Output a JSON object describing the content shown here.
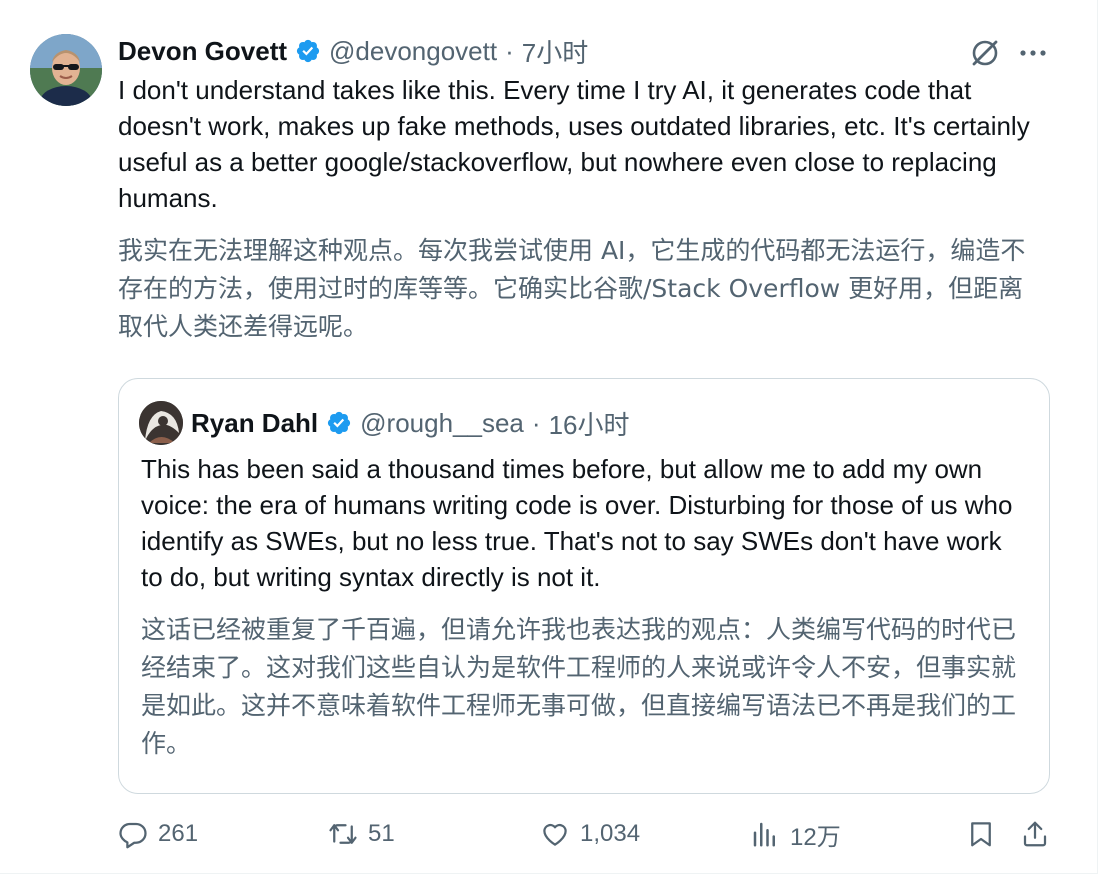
{
  "post": {
    "author_name": "Devon Govett",
    "handle": "@devongovett",
    "separator": "·",
    "time": "7小时",
    "text": "I don't understand takes like this. Every time I try AI, it generates code that doesn't work, makes up fake methods, uses outdated libraries, etc. It's certainly useful as a better google/stackoverflow, but nowhere even close to replacing humans.",
    "translation": "我实在无法理解这种观点。每次我尝试使用 AI，它生成的代码都无法运行，编造不存在的方法，使用过时的库等等。它确实比谷歌/Stack Overflow 更好用，但距离取代人类还差得远呢。"
  },
  "quote": {
    "author_name": "Ryan Dahl",
    "handle": "@rough__sea",
    "separator": "·",
    "time": "16小时",
    "text": "This has been said a thousand times before, but allow me to add my own voice: the era of humans writing code is over. Disturbing for those of us who identify as SWEs, but no less true. That's not to say SWEs don't have work to do, but writing syntax directly is not it.",
    "translation": "这话已经被重复了千百遍，但请允许我也表达我的观点：人类编写代码的时代已经结束了。这对我们这些自认为是软件工程师的人来说或许令人不安，但事实就是如此。这并不意味着软件工程师无事可做，但直接编写语法已不再是我们的工作。"
  },
  "actions": {
    "replies": "261",
    "reposts": "51",
    "likes": "1,034",
    "views": "12万"
  },
  "colors": {
    "verified": "#1d9bf0",
    "text": "#0f1419",
    "secondary": "#536471",
    "border": "#cfd9de"
  },
  "icons": [
    "verified-badge-icon",
    "grok-icon",
    "more-icon",
    "reply-icon",
    "repost-icon",
    "like-icon",
    "views-icon",
    "bookmark-icon",
    "share-icon"
  ]
}
